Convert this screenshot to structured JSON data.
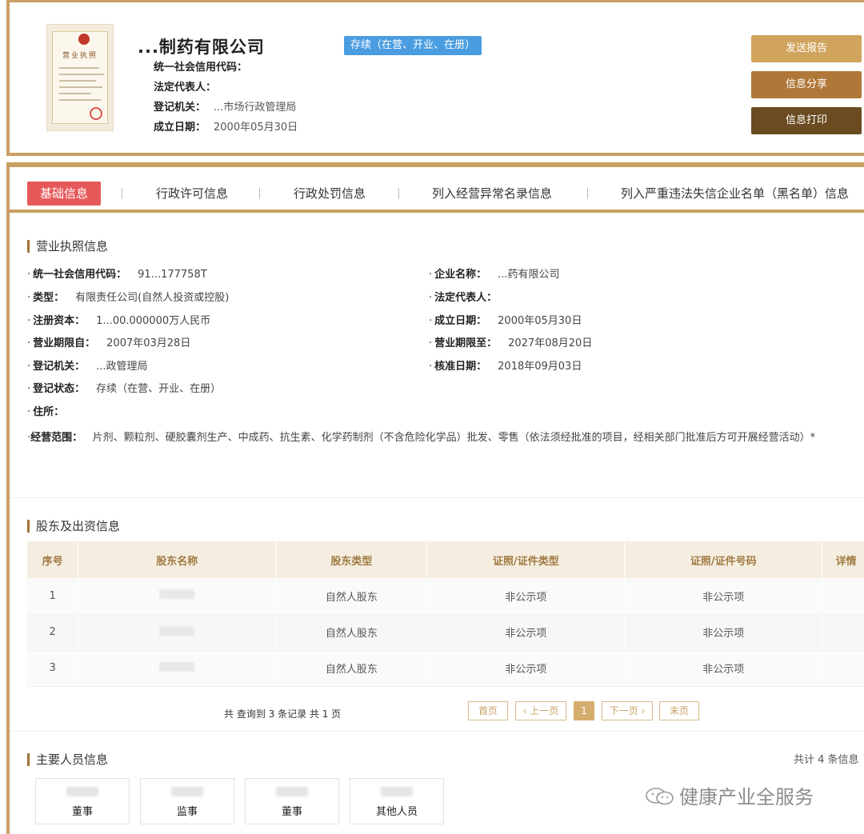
{
  "header": {
    "license_title": "营业执照",
    "company_name": "...制药有限公司",
    "status": "存续（在营、开业、在册）",
    "credit_code_label": "统一社会信用代码：",
    "credit_code": "",
    "legal_rep_label": "法定代表人：",
    "legal_rep": "",
    "reg_authority_label": "登记机关：",
    "reg_authority": "...市场行政管理局",
    "founded_label": "成立日期：",
    "founded": "2000年05月30日"
  },
  "actions": {
    "send_report": "发送报告",
    "share_info": "信息分享",
    "print_info": "信息打印"
  },
  "tabs": [
    {
      "label": "基础信息",
      "active": true
    },
    {
      "label": "行政许可信息"
    },
    {
      "label": "行政处罚信息"
    },
    {
      "label": "列入经营异常名录信息"
    },
    {
      "label": "列入严重违法失信企业名单（黑名单）信息"
    }
  ],
  "license_section": {
    "title": "营业执照信息",
    "left": [
      {
        "label": "统一社会信用代码：",
        "value": "91...177758T"
      },
      {
        "label": "类型：",
        "value": "有限责任公司(自然人投资或控股)"
      },
      {
        "label": "注册资本：",
        "value": "1...00.000000万人民币"
      },
      {
        "label": "营业期限自：",
        "value": "2007年03月28日"
      },
      {
        "label": "登记机关：",
        "value": "...政管理局"
      },
      {
        "label": "登记状态：",
        "value": "存续（在营、开业、在册）"
      },
      {
        "label": "住所：",
        "value": ""
      }
    ],
    "right": [
      {
        "label": "企业名称：",
        "value": "...药有限公司"
      },
      {
        "label": "法定代表人：",
        "value": ""
      },
      {
        "label": "成立日期：",
        "value": "2000年05月30日"
      },
      {
        "label": "营业期限至：",
        "value": "2027年08月20日"
      },
      {
        "label": "核准日期：",
        "value": "2018年09月03日"
      }
    ],
    "scope_label": "经营范围：",
    "scope_value": "片剂、颗粒剂、硬胶囊剂生产、中成药、抗生素、化学药制剂（不含危险化学品）批发、零售（依法须经批准的项目，经相关部门批准后方可开展经营活动）*"
  },
  "shareholders": {
    "title": "股东及出资信息",
    "columns": [
      "序号",
      "股东名称",
      "股东类型",
      "证照/证件类型",
      "证照/证件号码",
      "详情"
    ],
    "rows": [
      {
        "no": "1",
        "type": "自然人股东",
        "id_type": "非公示项",
        "id_no": "非公示项"
      },
      {
        "no": "2",
        "type": "自然人股东",
        "id_type": "非公示项",
        "id_no": "非公示项"
      },
      {
        "no": "3",
        "type": "自然人股东",
        "id_type": "非公示项",
        "id_no": "非公示项"
      }
    ],
    "pager_info": "共 查询到 3 条记录 共 1 页",
    "first": "首页",
    "prev": "‹ 上一页",
    "current": "1",
    "next": "下一页 ›",
    "last": "末页"
  },
  "personnel": {
    "title": "主要人员信息",
    "total": "共计 4 条信息",
    "roles": [
      "董事",
      "监事",
      "董事",
      "其他人员"
    ]
  },
  "watermark": "健康产业全服务",
  "colors": {
    "gold": "#c9a063",
    "tab_active": "#e6595a",
    "status_blue": "#4a9de0"
  }
}
